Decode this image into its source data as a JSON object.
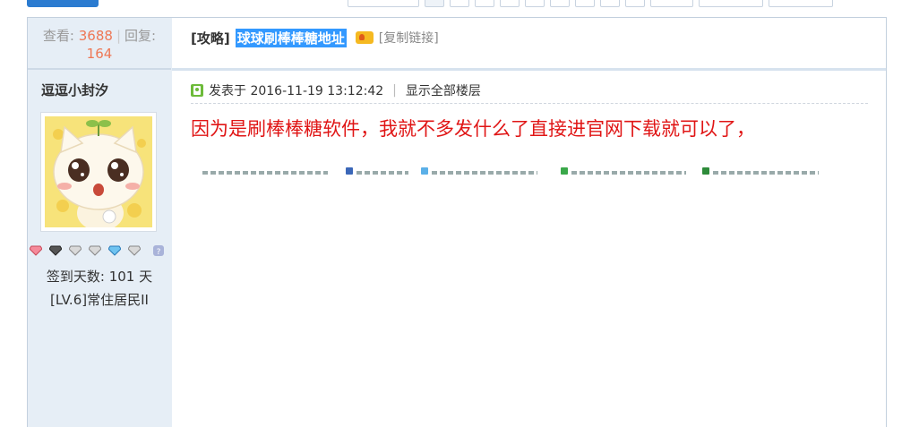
{
  "stats": {
    "views_label": "查看:",
    "views": "3688",
    "replies_label": "回复:",
    "replies": "164"
  },
  "thread": {
    "category": "[攻略]",
    "title": "球球刷棒棒糖地址",
    "copy_link": "[复制链接]"
  },
  "author": {
    "name": "逗逗小封汐",
    "signin_days": "签到天数: 101 天",
    "rank": "[LV.6]常住居民II"
  },
  "post": {
    "posted_at": "发表于 2016-11-19 13:12:42",
    "show_all": "显示全部楼层",
    "content": "因为是刷棒棒糖软件，我就不多发什么了直接进官网下载就可以了，"
  },
  "colors": {
    "highlight": "#3399ff",
    "content_red": "#e01515",
    "stat_number": "#ee7755",
    "sidebar_bg": "#e6eef6"
  },
  "icons": {
    "hot": "hot-flame-icon",
    "post": "post-author-icon",
    "medals": [
      "heart-gem-icon",
      "dark-gem-icon",
      "gem-icon",
      "gem-icon",
      "blue-gem-icon",
      "gem-icon",
      "help-icon"
    ]
  }
}
